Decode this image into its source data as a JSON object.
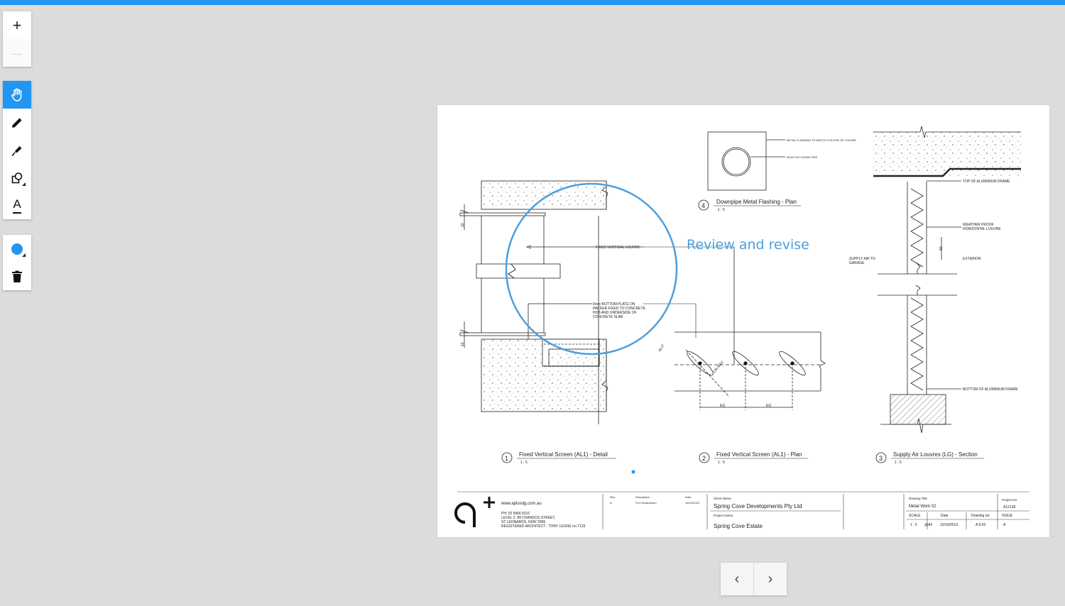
{
  "toolbar": {
    "zoom_in": "+",
    "zoom_out": "—",
    "text_tool": "A",
    "active_tool": "pan",
    "color": "#2196f3"
  },
  "annotation": {
    "text": "Review and revise"
  },
  "drawing": {
    "callouts": {
      "metal_flashing": "METAL FLASHING TO MATCH COLOUR OF LOUVRE",
      "pvc_pipe": "Ø100 PVC DOWN PIPE",
      "fixed_louvre": "FIXED VERTICAL LOUVRE",
      "plate_1": "6mm BOTTOM PLATE ON",
      "plate_2": "PACKER FIXED TO CONCRETE",
      "plate_3": "HOB AND UNDERSIDE OF",
      "plate_4": "CONCRETE SLAB",
      "top_frame": "TOP OF ALUMINIUM FRAME",
      "weather_1": "WEATHER PROOF",
      "weather_2": "HORIZONTAL LOUVRE",
      "supply_1": "SUPPLY AIR TO",
      "supply_2": "GARAGE",
      "exterior": "EXTERIOR",
      "bottom_frame": "BOTTOM OF ALUMINIUM FRAME",
      "dim_80": "80",
      "eq": "EQ",
      "angle": "45.0°",
      "dim_10a": "10",
      "dim_10b": "10",
      "max": "135 MAX"
    },
    "details": [
      {
        "num": "4",
        "title": "Downpipe Metal Flashing - Plan",
        "scale": "1 : 5"
      },
      {
        "num": "1",
        "title": "Fixed Vertical Screen (AL1) - Detail",
        "scale": "1 : 5"
      },
      {
        "num": "2",
        "title": "Fixed Vertical Screen (AL1) - Plan",
        "scale": "1 : 5"
      },
      {
        "num": "3",
        "title": "Supply Air Louvres (LG) - Section",
        "scale": "1 : 5"
      }
    ],
    "title_block": {
      "website": "www.aplusdg.com.au",
      "phone": "PH: 02 9966 8116",
      "address1": "LEVEL 2, 89 CHANDOS STREET,",
      "address2": "ST LEONARDS,  NSW 2065",
      "architect": "REGISTERED ARCHITECT - TONY LEUNG no.7133",
      "rev_h": "Rev",
      "desc_h": "Description",
      "date_h": "Date",
      "rev": "A",
      "desc": "For Construction",
      "date": "10/10/2013",
      "client_label": "Client Name",
      "client": "Spring Cove Developments Pty Ltd",
      "project_label": "Project Name",
      "project": "Spring Cove Estate",
      "drawing_title_label": "Drawing Title",
      "drawing_title": "Metal Work 02",
      "project_no_label": "Project No.",
      "project_no": "A12138",
      "scale_label": "SCALE",
      "date_label": "Date",
      "drawing_no_label": "Drawing no:",
      "issue_label": "ISSUE",
      "scale": "1 : 5",
      "paper": "@A3",
      "date2": "10/10/2013",
      "drawing_no": "A 9.02",
      "issue": "A"
    }
  },
  "pager": {
    "prev": "‹",
    "next": "›"
  }
}
